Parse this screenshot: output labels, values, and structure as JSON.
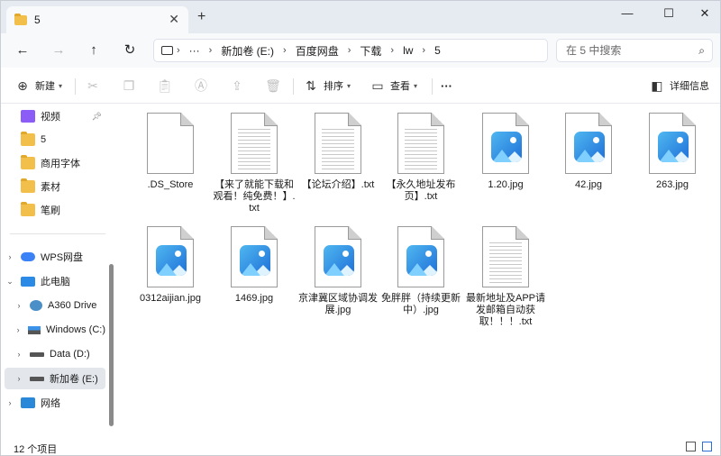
{
  "tab": {
    "title": "5"
  },
  "nav": {
    "breadcrumb": [
      "新加卷 (E:)",
      "百度网盘",
      "下载",
      "lw",
      "5"
    ],
    "more": "···",
    "search_placeholder": "在 5 中搜索"
  },
  "toolbar": {
    "new_label": "新建",
    "sort_label": "排序",
    "view_label": "查看",
    "more_label": "···",
    "details_label": "详细信息"
  },
  "sidebar": {
    "quick": [
      "视频",
      "5",
      "商用字体",
      "素材",
      "笔刷"
    ],
    "wps": "WPS网盘",
    "pc": "此电脑",
    "drives": [
      "A360 Drive",
      "Windows (C:)",
      "Data (D:)",
      "新加卷 (E:)"
    ],
    "network": "网络"
  },
  "files": [
    {
      "name": ".DS_Store",
      "kind": "blank"
    },
    {
      "name": "【来了就能下载和观看！纯免费！】.txt",
      "kind": "text"
    },
    {
      "name": "【论坛介绍】.txt",
      "kind": "text"
    },
    {
      "name": "【永久地址发布页】.txt",
      "kind": "text"
    },
    {
      "name": "1.20.jpg",
      "kind": "image"
    },
    {
      "name": "42.jpg",
      "kind": "image"
    },
    {
      "name": "263.jpg",
      "kind": "image"
    },
    {
      "name": "0312aijian.jpg",
      "kind": "image"
    },
    {
      "name": "1469.jpg",
      "kind": "image"
    },
    {
      "name": "京津冀区域协调发展.jpg",
      "kind": "image"
    },
    {
      "name": "免胖胖（持续更新中）.jpg",
      "kind": "image"
    },
    {
      "name": "最新地址及APP请发邮箱自动获取！！！.txt",
      "kind": "text"
    }
  ],
  "status": {
    "count": "12 个项目"
  }
}
